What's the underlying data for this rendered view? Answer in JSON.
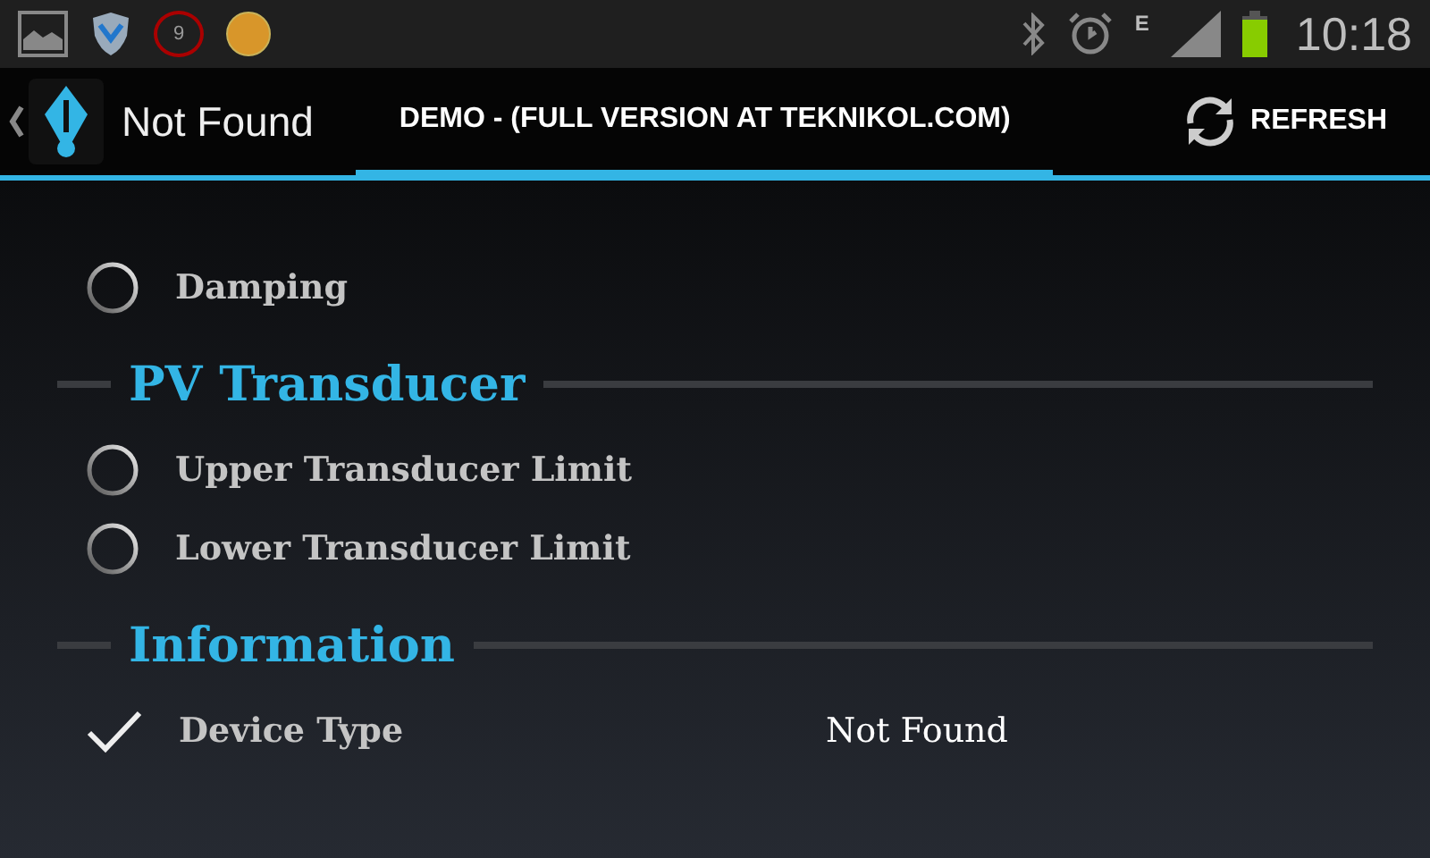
{
  "status_bar": {
    "notification_badge": "9",
    "network": "E",
    "time": "10:18"
  },
  "action_bar": {
    "title": "Not Found",
    "tabs": [
      {
        "label": "DEMO - (FULL VERSION AT TEKNIKOL.COM)",
        "selected": true
      }
    ],
    "refresh": "REFRESH"
  },
  "sections": [
    {
      "items": [
        {
          "kind": "loading",
          "label": "Damping"
        }
      ]
    },
    {
      "title": "PV Transducer",
      "items": [
        {
          "kind": "loading",
          "label": "Upper Transducer Limit"
        },
        {
          "kind": "loading",
          "label": "Lower Transducer Limit"
        }
      ]
    },
    {
      "title": "Information",
      "items": [
        {
          "kind": "done",
          "label": "Device Type",
          "value": "Not Found"
        }
      ]
    }
  ]
}
